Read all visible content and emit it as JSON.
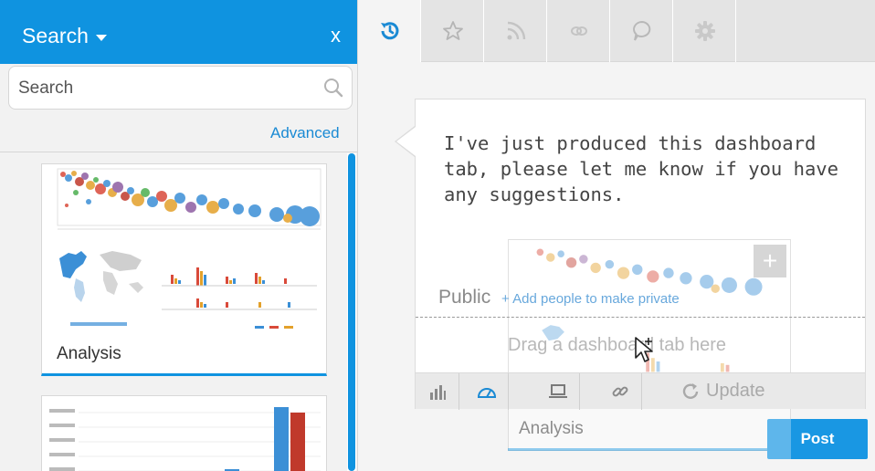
{
  "search_panel": {
    "title": "Search",
    "close_label": "x",
    "search_placeholder": "Search",
    "advanced_link": "Advanced",
    "results": [
      {
        "label": "Analysis"
      },
      {
        "label": ""
      }
    ]
  },
  "tabs": [
    {
      "name": "timeline",
      "icon": "history-icon",
      "active": true
    },
    {
      "name": "favourites",
      "icon": "star-icon",
      "active": false
    },
    {
      "name": "feed",
      "icon": "rss-icon",
      "active": false
    },
    {
      "name": "links",
      "icon": "link-icon",
      "active": false
    },
    {
      "name": "comments",
      "icon": "speech-bubble-icon",
      "active": false
    },
    {
      "name": "settings",
      "icon": "gear-icon",
      "active": false
    }
  ],
  "comment": {
    "text": "I've just produced this dashboard tab, please let me know if you have any suggestions.",
    "visibility_label": "Public",
    "add_people_link": "+ Add people to make private",
    "drag_hint": "Drag a dashboard tab here",
    "update_label": "Update",
    "attached_card_label": "Analysis",
    "post_label": "Post"
  },
  "colors": {
    "accent": "#0f93e0",
    "link": "#1a8ad4"
  }
}
